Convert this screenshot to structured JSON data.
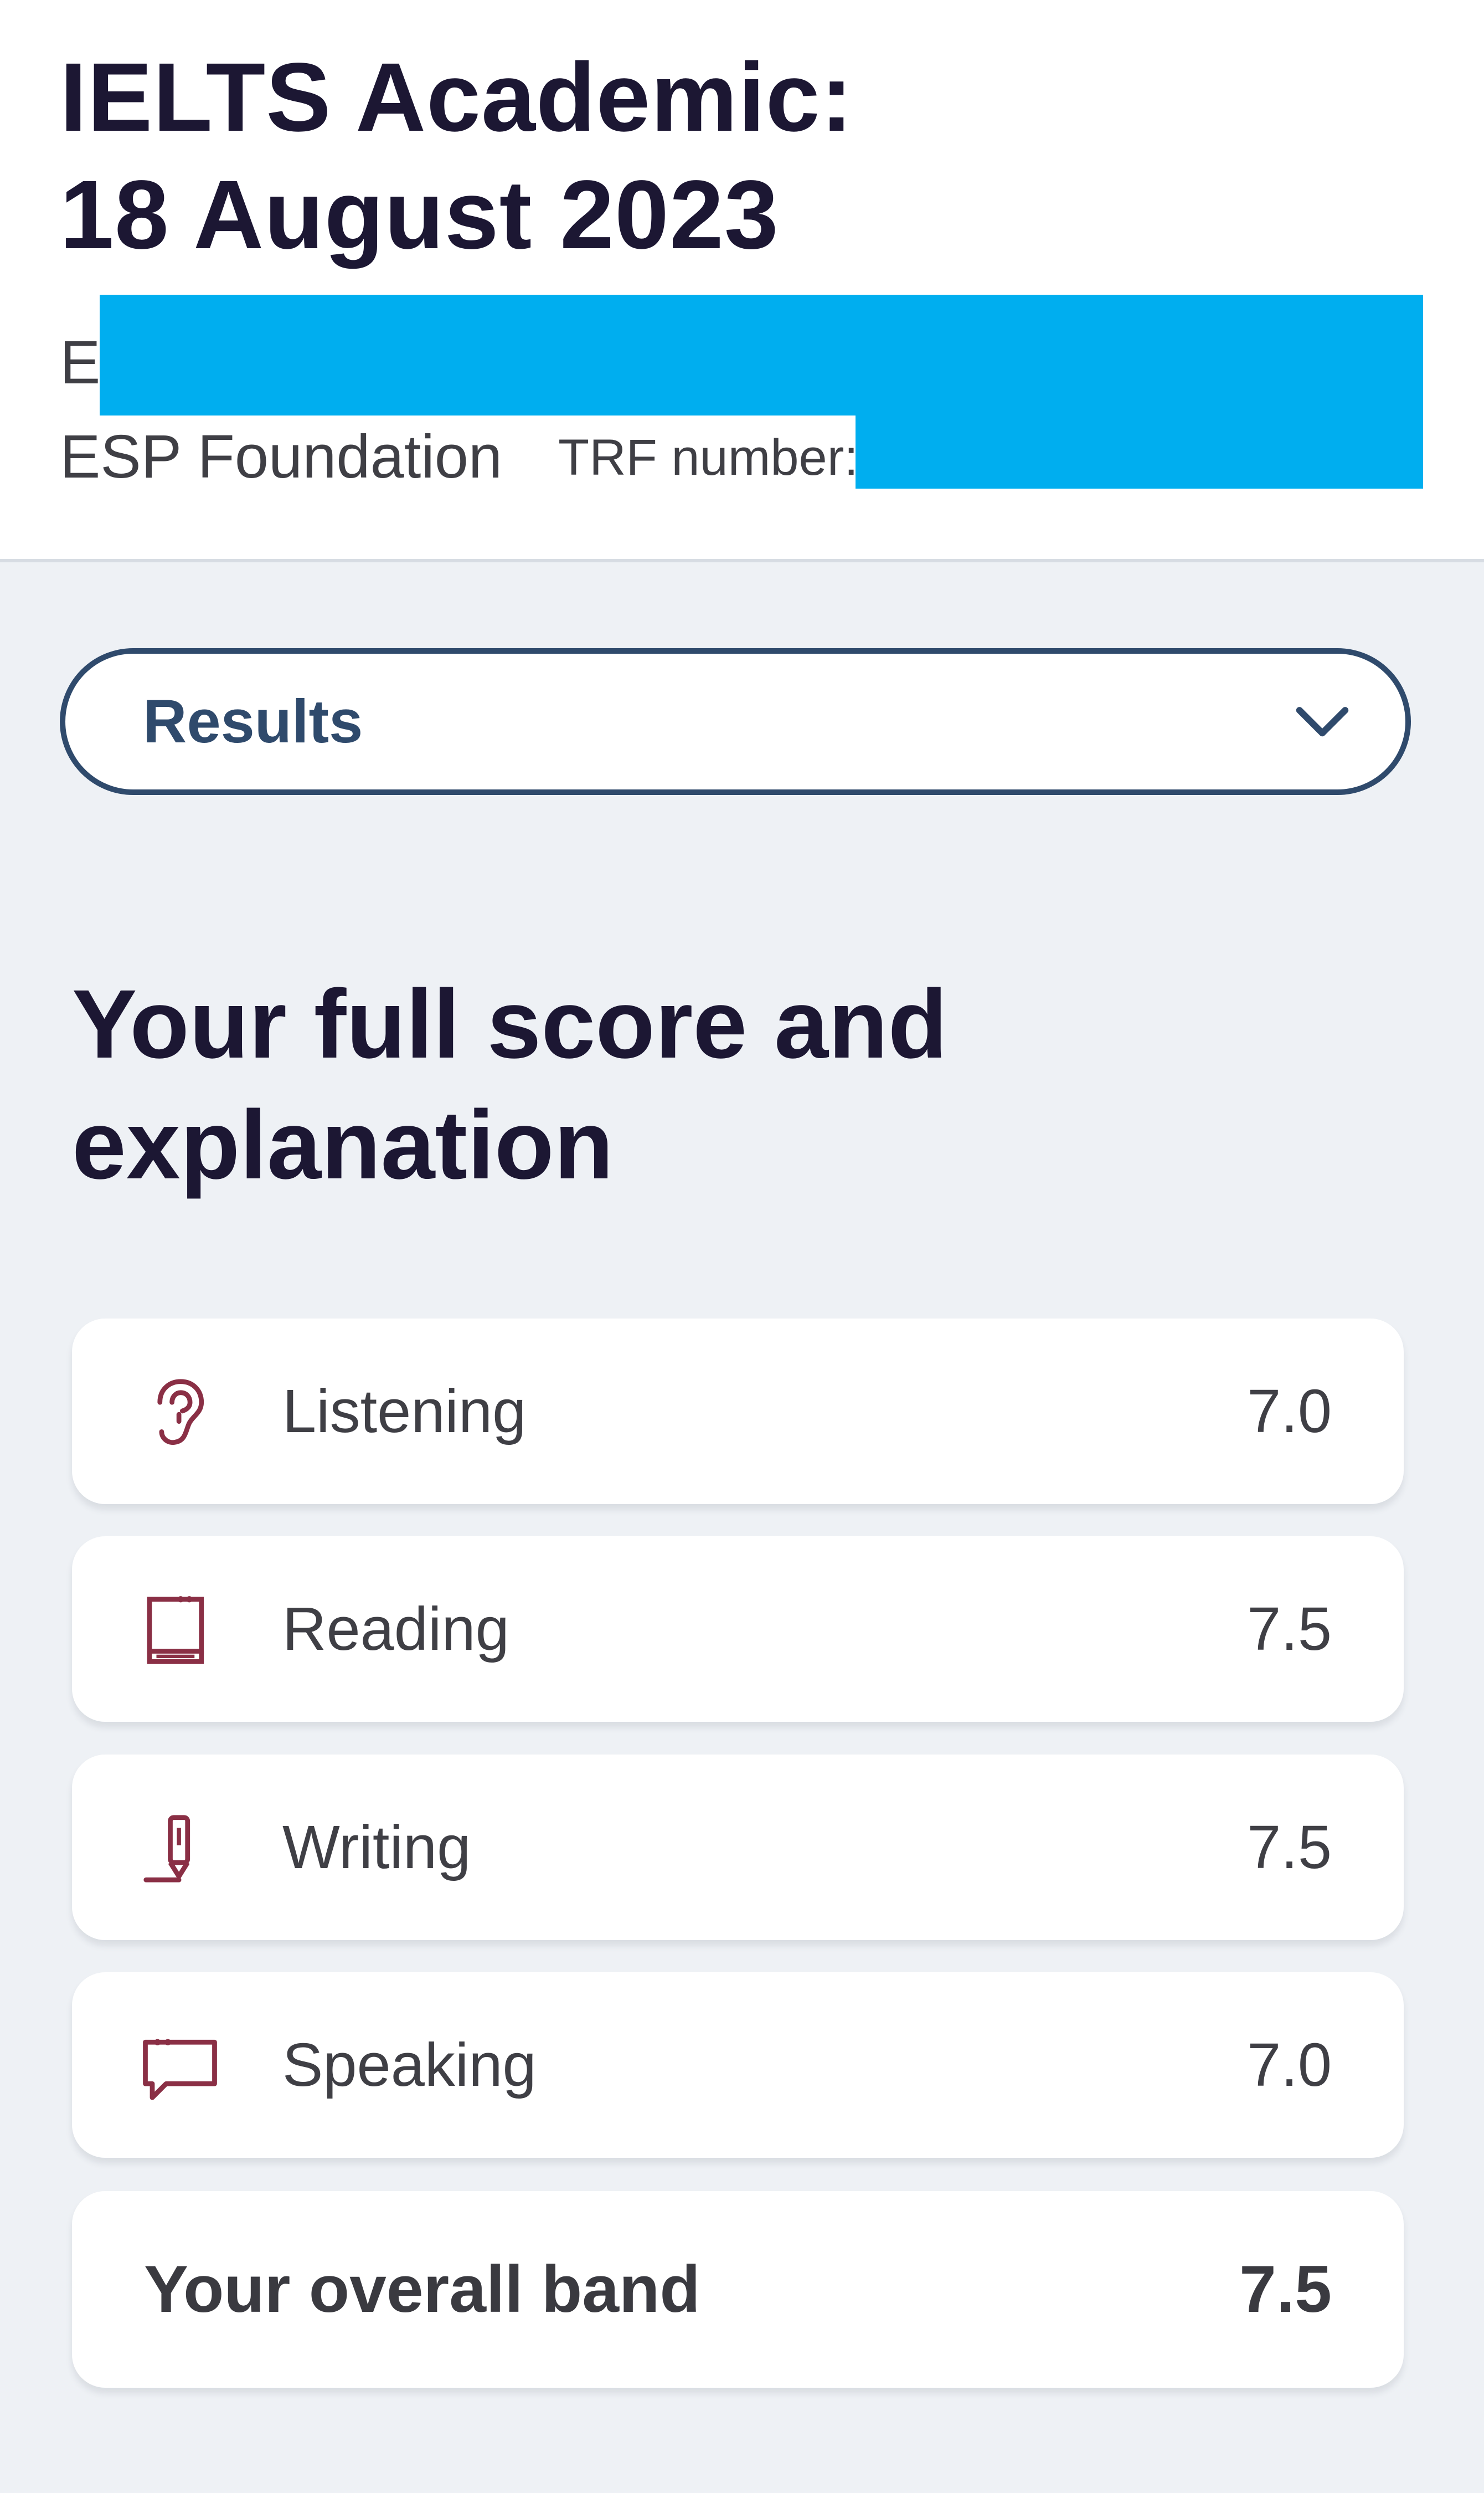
{
  "header": {
    "title_line1": "IELTS Academic:",
    "title_line2": "18 August 2023",
    "candidate_initial": "E",
    "centre_name": "ESP Foundation",
    "trf_label": "TRF number:"
  },
  "dropdown": {
    "selected": "Results"
  },
  "section": {
    "title_line1": "Your full score and",
    "title_line2": "explanation"
  },
  "scores": [
    {
      "label": "Listening",
      "value": "7.0",
      "icon": "ear-icon"
    },
    {
      "label": "Reading",
      "value": "7.5",
      "icon": "book-icon"
    },
    {
      "label": "Writing",
      "value": "7.5",
      "icon": "pen-icon"
    },
    {
      "label": "Speaking",
      "value": "7.0",
      "icon": "speech-bubble-icon"
    }
  ],
  "overall": {
    "label": "Your overall band",
    "value": "7.5"
  },
  "colors": {
    "title": "#1c1733",
    "accent": "#2f4a6c",
    "icon": "#8a2f45",
    "redaction": "#00aeef"
  }
}
